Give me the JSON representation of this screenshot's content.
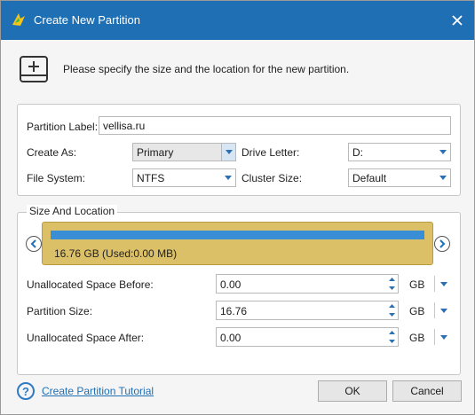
{
  "window": {
    "title": "Create New Partition",
    "header_text": "Please specify the size and the location for the new partition.",
    "accent_color": "#1f6fb5"
  },
  "partition": {
    "label_caption": "Partition Label:",
    "label_value": "vellisa.ru",
    "create_as_caption": "Create As:",
    "create_as_value": "Primary",
    "drive_letter_caption": "Drive Letter:",
    "drive_letter_value": "D:",
    "file_system_caption": "File System:",
    "file_system_value": "NTFS",
    "cluster_size_caption": "Cluster Size:",
    "cluster_size_value": "Default"
  },
  "size_location": {
    "group_title": "Size And Location",
    "disk_text": "16.76 GB (Used:0.00 MB)",
    "disk_fill_fraction": 1.0,
    "disk_color": "#dcc068",
    "fill_color": "#3a8ed6",
    "before_caption": "Unallocated Space Before:",
    "before_value": "0.00",
    "before_unit": "GB",
    "size_caption": "Partition Size:",
    "size_value": "16.76",
    "size_unit": "GB",
    "after_caption": "Unallocated Space After:",
    "after_value": "0.00",
    "after_unit": "GB"
  },
  "footer": {
    "tutorial_link": "Create Partition Tutorial",
    "ok_label": "OK",
    "cancel_label": "Cancel"
  },
  "icons": {
    "app": "minitool-logo-icon",
    "close": "close-icon",
    "header": "disk-plus-icon",
    "help": "help-icon",
    "nav_left": "chevron-left-icon",
    "nav_right": "chevron-right-icon"
  }
}
